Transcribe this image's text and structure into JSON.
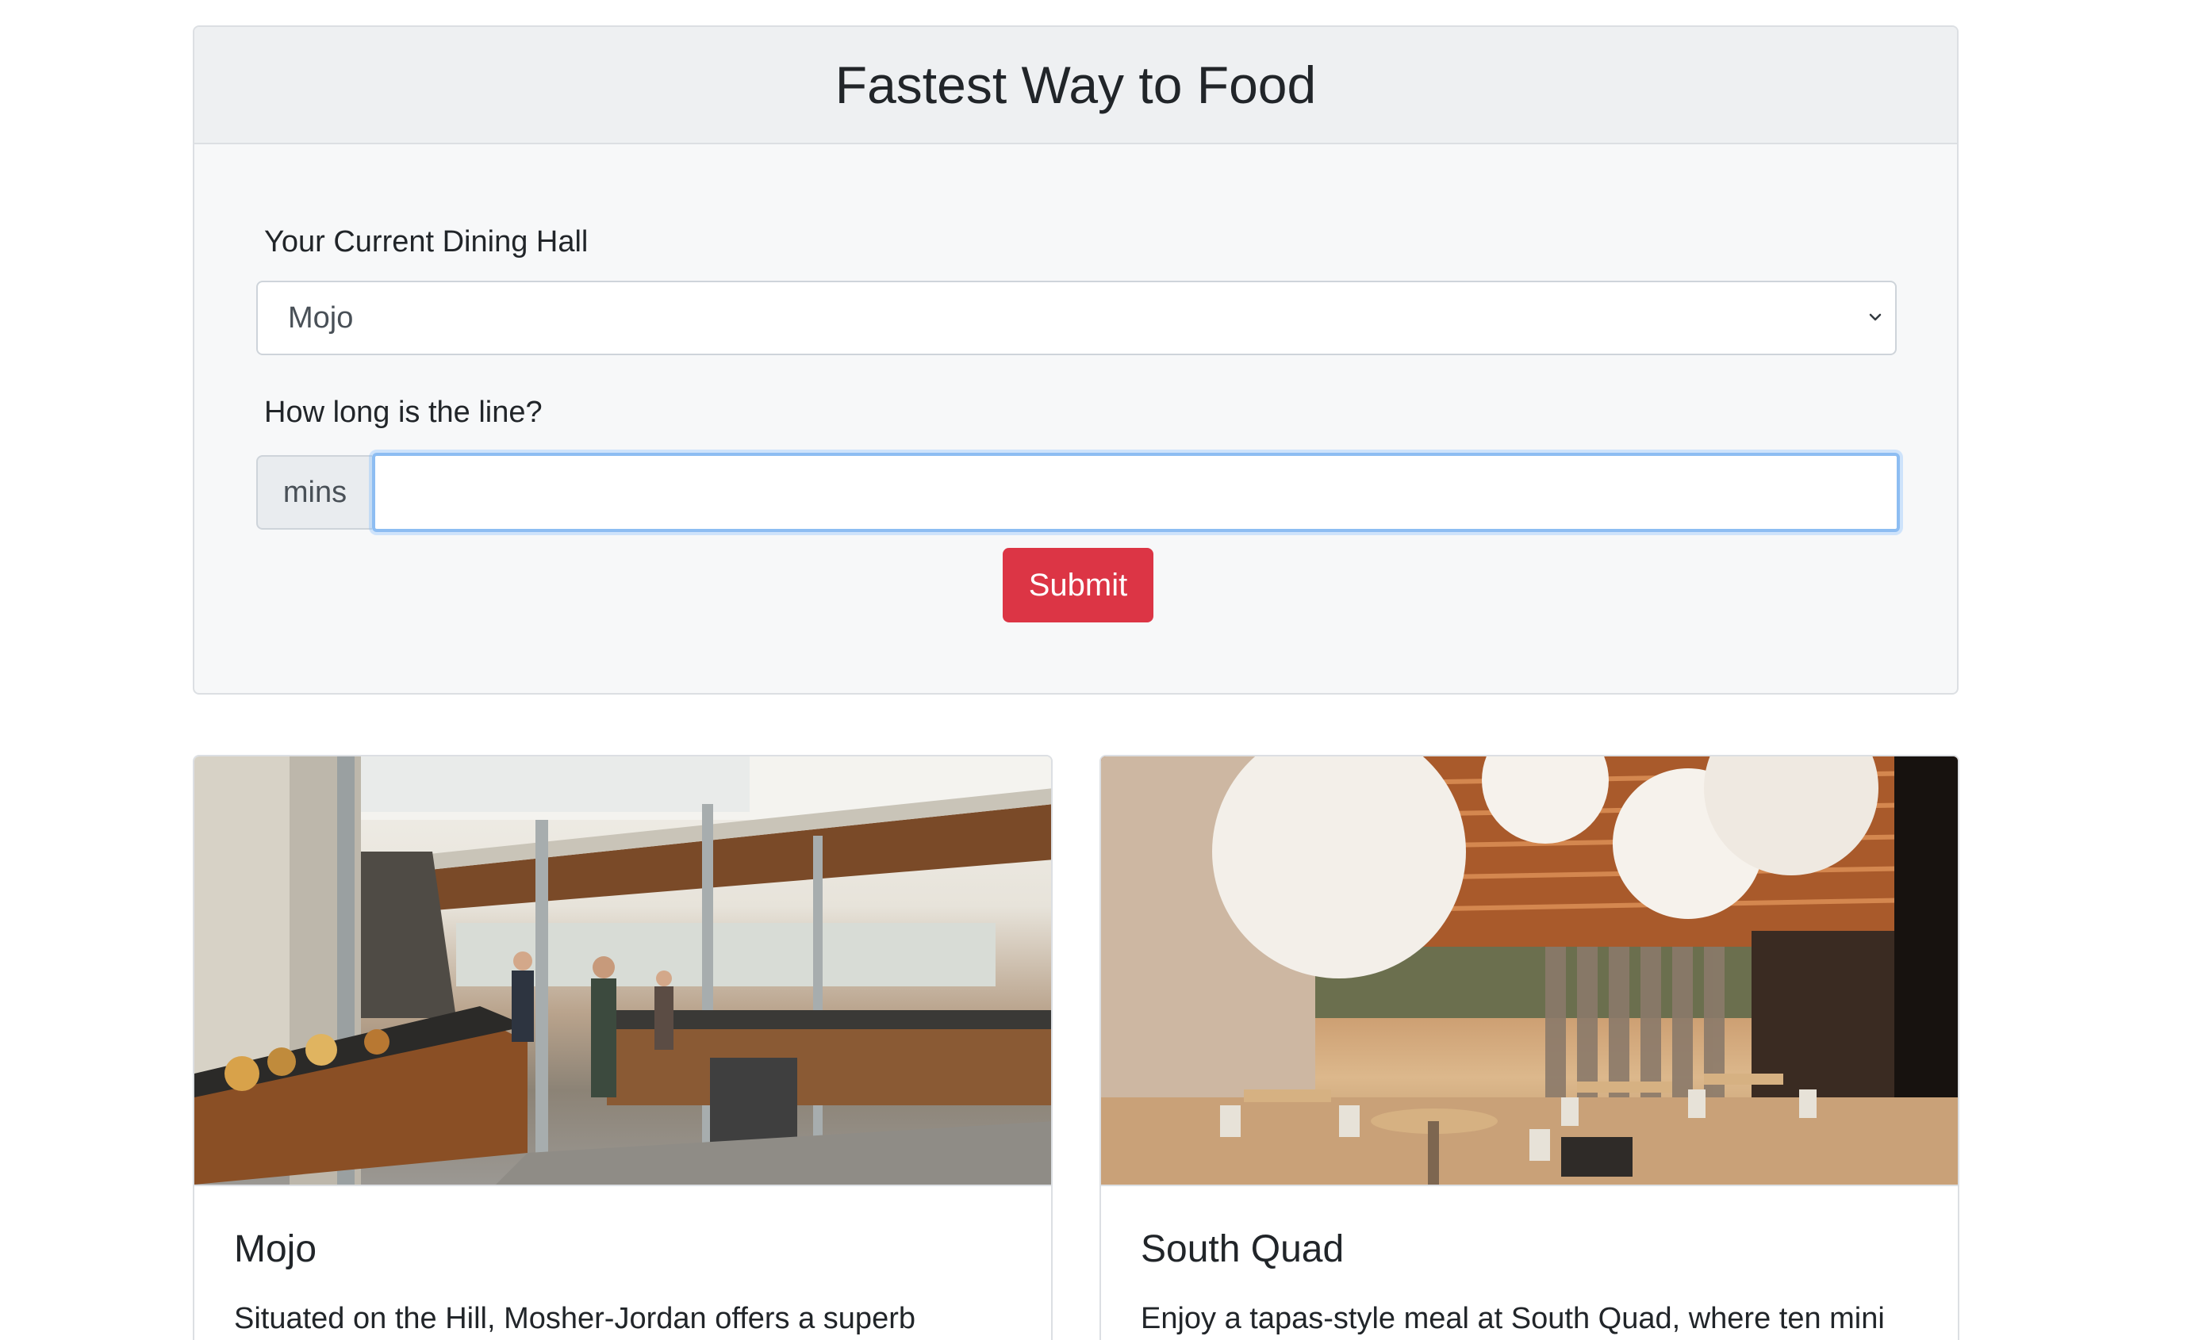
{
  "form": {
    "title": "Fastest Way to Food",
    "dining_hall_label": "Your Current Dining Hall",
    "dining_hall_selected": "Mojo",
    "line_label": "How long is the line?",
    "line_addon": "mins",
    "line_value": "",
    "submit_label": "Submit"
  },
  "halls": [
    {
      "name": "Mojo",
      "description": "Situated on the Hill, Mosher-Jordan offers a superb"
    },
    {
      "name": "South Quad",
      "description": "Enjoy a tapas-style meal at South Quad, where ten mini"
    }
  ],
  "colors": {
    "submit": "#dc3545",
    "focus_border": "#8dbdf2"
  }
}
